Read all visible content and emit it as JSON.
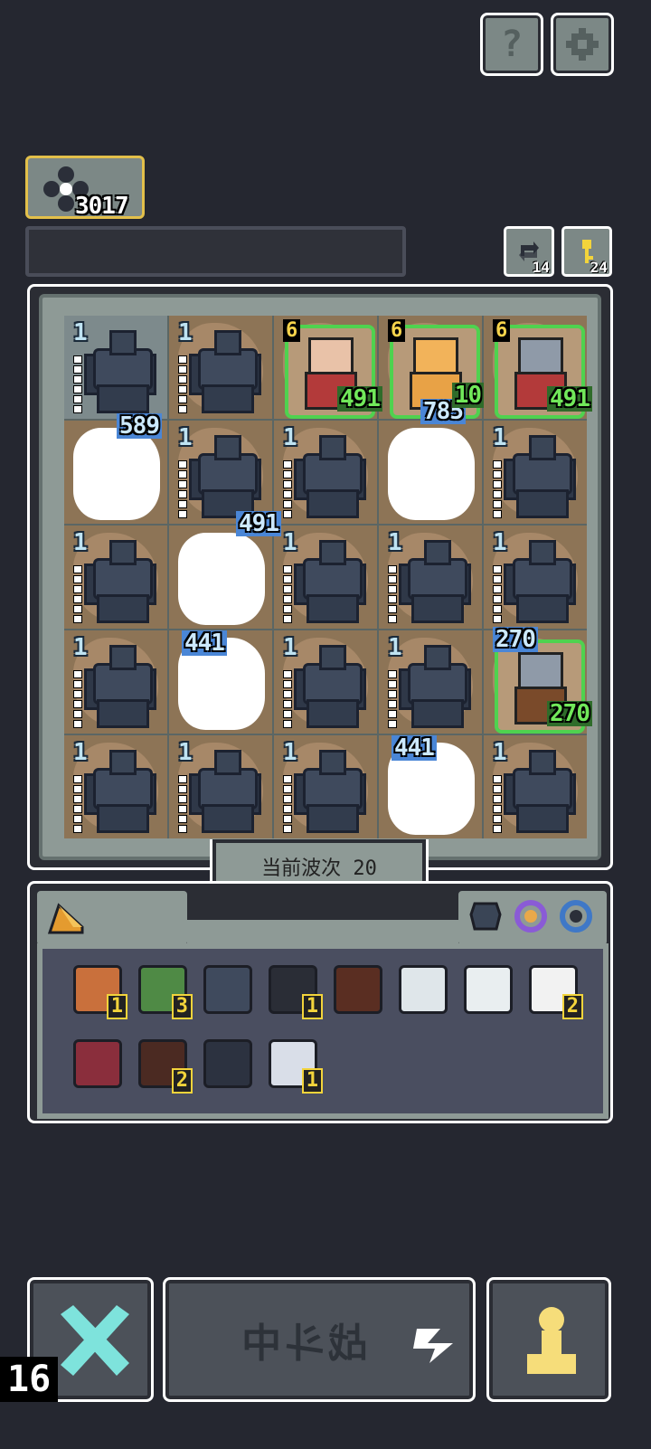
{
  "top_buttons": {
    "help_icon": "?",
    "settings_icon": "gear"
  },
  "currency": {
    "value": "3017",
    "icon": "flower-icon"
  },
  "counters": [
    {
      "value": "14",
      "icon": "refresh-icon"
    },
    {
      "value": "24",
      "icon": "key-icon"
    }
  ],
  "board": {
    "cells": [
      {
        "type": "golem",
        "level": "1",
        "selected": true
      },
      {
        "type": "golem",
        "level": "1"
      },
      {
        "type": "hero",
        "level": "6",
        "hp": "491",
        "hero": "knight-girl"
      },
      {
        "type": "hero",
        "level": "6",
        "hp": "785",
        "hp2": "10",
        "hero": "gold-warrior"
      },
      {
        "type": "hero",
        "level": "6",
        "hp": "491",
        "hero": "armored-knight"
      },
      {
        "type": "cloud",
        "dmg": "589"
      },
      {
        "type": "golem",
        "level": "1",
        "dmg": "491"
      },
      {
        "type": "golem",
        "level": "1"
      },
      {
        "type": "cloud"
      },
      {
        "type": "golem",
        "level": "1"
      },
      {
        "type": "golem",
        "level": "1"
      },
      {
        "type": "cloud"
      },
      {
        "type": "golem",
        "level": "1"
      },
      {
        "type": "golem",
        "level": "1"
      },
      {
        "type": "golem",
        "level": "1"
      },
      {
        "type": "golem",
        "level": "1"
      },
      {
        "type": "cloud",
        "dmg": "441"
      },
      {
        "type": "golem",
        "level": "1"
      },
      {
        "type": "golem",
        "level": "1"
      },
      {
        "type": "hero",
        "level": "",
        "hp": "270",
        "dmg": "270",
        "hero": "shield-knight"
      },
      {
        "type": "golem",
        "level": "1"
      },
      {
        "type": "golem",
        "level": "1"
      },
      {
        "type": "golem",
        "level": "1"
      },
      {
        "type": "cloud",
        "dmg": "441"
      },
      {
        "type": "golem",
        "level": "1"
      }
    ]
  },
  "wave_label": "当前波次 20",
  "inventory": {
    "tab_icon": "cheese-icon",
    "gems": [
      "dark-gem-icon",
      "purple-ring-icon",
      "blue-ring-icon"
    ],
    "items": [
      {
        "icon": "bucket-icon",
        "count": "1",
        "color": "#c9703c"
      },
      {
        "icon": "green-bag-icon",
        "count": "3",
        "color": "#4f8a45"
      },
      {
        "icon": "shield-icon",
        "count": "",
        "color": "#3f4a5d"
      },
      {
        "icon": "flower-icon",
        "count": "1",
        "color": "#2a2d36"
      },
      {
        "icon": "crate-icon",
        "count": "",
        "color": "#5a2e22"
      },
      {
        "icon": "crystal-icon",
        "count": "",
        "color": "#dfe6ea"
      },
      {
        "icon": "scroll-icon",
        "count": "",
        "color": "#e9eef0"
      },
      {
        "icon": "cotton-icon",
        "count": "2",
        "color": "#f2f2f2"
      },
      {
        "icon": "boot-icon",
        "count": "",
        "color": "#8a2e3c"
      },
      {
        "icon": "claw-icon",
        "count": "2",
        "color": "#4b2a22"
      },
      {
        "icon": "compass-icon",
        "count": "",
        "color": "#2c3240"
      },
      {
        "icon": "anvil-icon",
        "count": "1",
        "color": "#d9dee8"
      }
    ]
  },
  "bottom": {
    "round": "16",
    "battle_label": "战斗中",
    "cancel_icon": "x-icon",
    "pawn_icon": "pawn-icon"
  }
}
